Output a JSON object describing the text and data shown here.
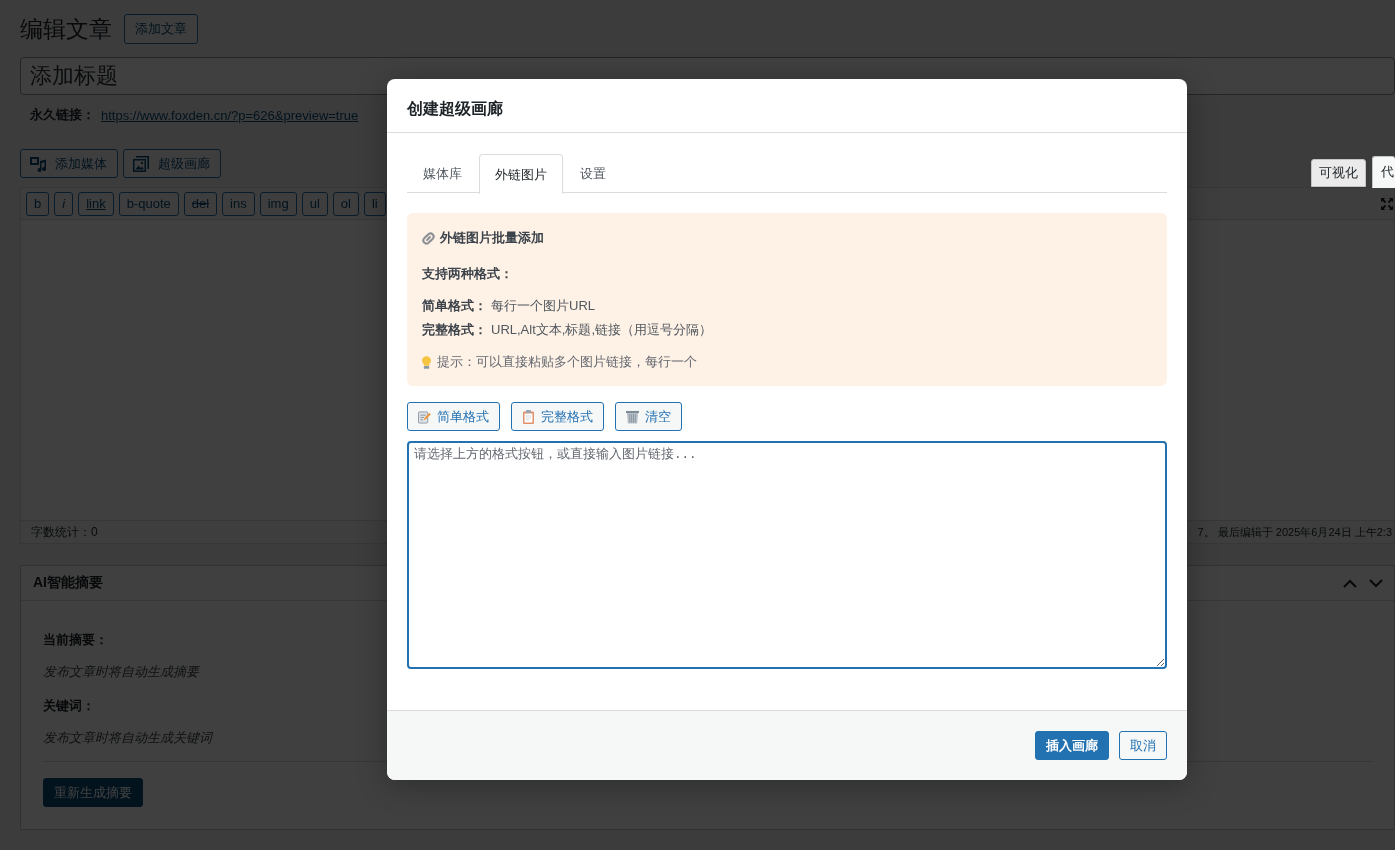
{
  "editor_page": {
    "heading": "编辑文章",
    "add_new_button": "添加文章",
    "title_field": {
      "placeholder": "添加标题"
    },
    "permalink": {
      "label": "永久链接：",
      "url": "https://www.foxden.cn/?p=626&preview=true"
    },
    "media_buttons": [
      {
        "label": "添加媒体",
        "kind": "media"
      },
      {
        "label": "超级画廊",
        "kind": "gallery"
      }
    ],
    "editor_tabs": [
      {
        "label": "可视化",
        "selected": false
      },
      {
        "label": "代",
        "selected": true
      }
    ],
    "quicktags": [
      {
        "label": "b",
        "kind": "plain"
      },
      {
        "label": "i",
        "kind": "italic"
      },
      {
        "label": "link",
        "kind": "link"
      },
      {
        "label": "b-quote",
        "kind": "plain"
      },
      {
        "label": "del",
        "kind": "strike"
      },
      {
        "label": "ins",
        "kind": "plain"
      },
      {
        "label": "img",
        "kind": "plain"
      },
      {
        "label": "ul",
        "kind": "plain"
      },
      {
        "label": "ol",
        "kind": "plain"
      },
      {
        "label": "li",
        "kind": "plain"
      }
    ],
    "status_bar": {
      "word_count": "字数统计：0",
      "last_edited": "7。 最后编辑于 2025年6月24日 上午2:3"
    }
  },
  "ai_summary_box": {
    "title": "AI智能摘要",
    "summary_label": "当前摘要：",
    "summary_text": "发布文章时将自动生成摘要",
    "keywords_label": "关键词：",
    "keywords_text": "发布文章时将自动生成关键词",
    "regenerate_button": "重新生成摘要"
  },
  "dialog": {
    "title": "创建超级画廊",
    "tabs": [
      {
        "label": "媒体库",
        "selected": false
      },
      {
        "label": "外链图片",
        "selected": true
      },
      {
        "label": "设置",
        "selected": false
      }
    ],
    "notice": {
      "title": "外链图片批量添加",
      "subtitle": "支持两种格式：",
      "formats": [
        {
          "label": "简单格式：",
          "text": "每行一个图片URL"
        },
        {
          "label": "完整格式：",
          "text": "URL,Alt文本,标题,链接（用逗号分隔）"
        }
      ],
      "tip": "提示：可以直接粘贴多个图片链接，每行一个"
    },
    "template_buttons": [
      {
        "label": "简单格式",
        "kind": "memo"
      },
      {
        "label": "完整格式",
        "kind": "clipboard"
      },
      {
        "label": "清空",
        "kind": "wastebasket"
      }
    ],
    "links_field": {
      "placeholder": "请选择上方的格式按钮，或直接输入图片链接..."
    },
    "footer_buttons": [
      {
        "label": "插入画廊",
        "kind": "primary"
      },
      {
        "label": "取消",
        "kind": "secondary"
      }
    ]
  }
}
